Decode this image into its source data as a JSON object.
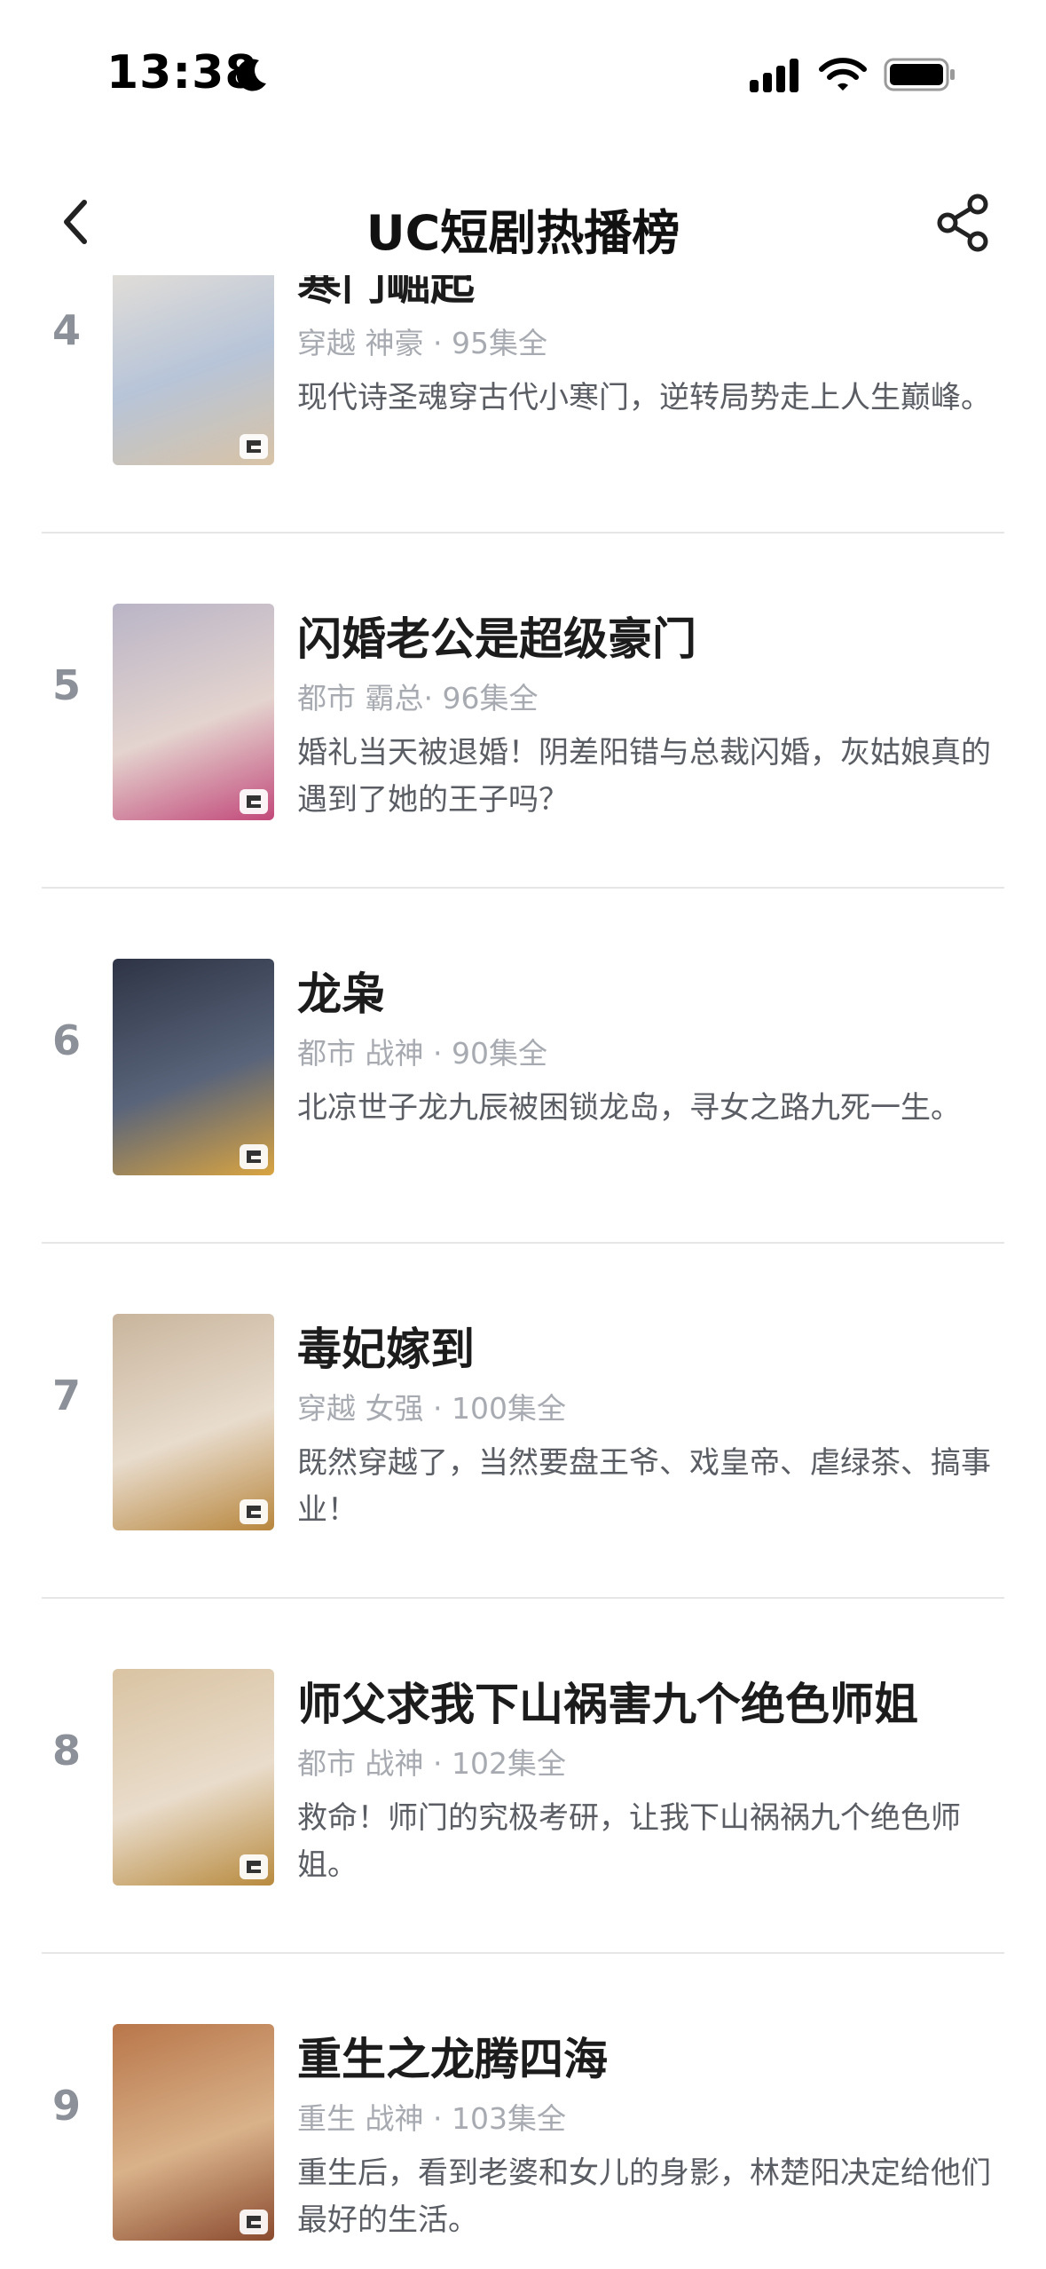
{
  "status_bar": {
    "time": "13:38",
    "icons": [
      "moon-icon",
      "signal-icon",
      "wifi-icon",
      "battery-icon"
    ]
  },
  "nav": {
    "title": "UC短剧热播榜",
    "back_icon": "chevron-left-icon",
    "share_icon": "share-icon"
  },
  "items": [
    {
      "rank": "4",
      "title": "寒门崛起",
      "meta": "穿越 神豪 · 95集全",
      "desc": "现代诗圣魂穿古代小寒门，逆转局势走上人生巅峰。",
      "poster_colors": [
        "#e9e2d8",
        "#b7c4d8",
        "#d8c3a6"
      ]
    },
    {
      "rank": "5",
      "title": "闪婚老公是超级豪门",
      "meta": "都市 霸总· 96集全",
      "desc": "婚礼当天被退婚！阴差阳错与总裁闪婚，灰姑娘真的遇到了她的王子吗？",
      "poster_colors": [
        "#b9b4c6",
        "#e4d4cf",
        "#c2497a"
      ]
    },
    {
      "rank": "6",
      "title": "龙枭",
      "meta": "都市 战神 · 90集全",
      "desc": "北凉世子龙九辰被困锁龙岛，寻女之路九死一生。",
      "poster_colors": [
        "#2e3445",
        "#59647a",
        "#d9a441"
      ]
    },
    {
      "rank": "7",
      "title": "毒妃嫁到",
      "meta": "穿越 女强 · 100集全",
      "desc": "既然穿越了，当然要盘王爷、戏皇帝、虐绿茶、搞事业！",
      "poster_colors": [
        "#c9b59d",
        "#e8dccd",
        "#b8863d"
      ]
    },
    {
      "rank": "8",
      "title": "师父求我下山祸害九个绝色师姐",
      "meta": "都市 战神 · 102集全",
      "desc": "救命！师门的究极考研，让我下山祸祸九个绝色师姐。",
      "poster_colors": [
        "#d9c3a2",
        "#e9dccb",
        "#b88a3e"
      ]
    },
    {
      "rank": "9",
      "title": "重生之龙腾四海",
      "meta": "重生 战神 · 103集全",
      "desc": "重生后，看到老婆和女儿的身影，林楚阳决定给他们最好的生活。",
      "poster_colors": [
        "#b9764a",
        "#d9b28a",
        "#8a4a2e"
      ]
    }
  ]
}
